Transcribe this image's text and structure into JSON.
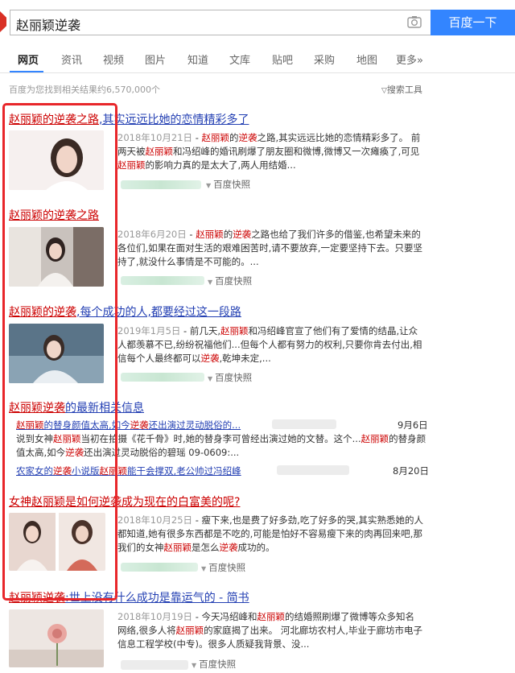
{
  "search": {
    "query": "赵丽颖逆袭",
    "button_label": "百度一下"
  },
  "tabs": [
    {
      "label": "网页",
      "active": true
    },
    {
      "label": "资讯"
    },
    {
      "label": "视频"
    },
    {
      "label": "图片"
    },
    {
      "label": "知道"
    },
    {
      "label": "文库"
    },
    {
      "label": "贴吧"
    },
    {
      "label": "采购"
    },
    {
      "label": "地图"
    },
    {
      "label": "更多»"
    }
  ],
  "result_count": "百度为您找到相关结果约6,570,000个",
  "search_tools": "搜索工具",
  "kuaizhao": "百度快照",
  "results": [
    {
      "title_hl": "赵丽颖的逆袭之路",
      "title_rest": ",其实远远比她的恋情精彩多了",
      "date": "2018年10月21日",
      "snippet": " - 赵丽颖的逆袭之路,其实远远比她的恋情精彩多了。 前两天被赵丽颖和冯绍峰的婚讯刷爆了朋友圈和微博,微博又一次瘫痪了,可见赵丽颖的影响力真的是太大了,两人用结婚..."
    },
    {
      "title_hl": "赵丽颖的逆袭之路",
      "title_rest": "",
      "date": "2018年6月20日",
      "snippet": " - 赵丽颖的逆袭之路也给了我们许多的借鉴,也希望未来的各位们,如果在面对生活的艰难困苦时,请不要放弃,一定要坚持下去。只要坚持了,就没什么事情是不可能的。..."
    },
    {
      "title_hl": "赵丽颖的逆袭",
      "title_rest": ",每个成功的人,都要经过这一段路",
      "date": "2019年1月5日",
      "snippet": " - 前几天,赵丽颖和冯绍峰官宣了他们有了爱情的结晶,让众人都羡慕不已,纷纷祝福他们...但每个人都有努力的权利,只要你肯去付出,相信每个人最终都可以逆袭,乾坤未定,..."
    },
    {
      "title_hl": "赵丽颖逆袭",
      "title_rest": "的最新相关信息",
      "news": [
        {
          "title": "赵丽颖的替身颜值太高,如今逆袭还出演过灵动脱俗的...",
          "date": "9月6日"
        },
        {
          "snippet": "说到女神赵丽颖当初在拍摄《花千骨》时,她的替身李可曾经出演过她的文替。这个...赵丽颖的替身颜值太高,如今逆袭还出演过灵动脱俗的碧瑶 09-0609:..."
        },
        {
          "title": "农家女的逆袭小说版赵丽颖能干会撑双,老公帅过冯绍峰",
          "date": "8月20日"
        }
      ]
    },
    {
      "title_hl": "女神赵丽颖是如何逆袭成为现在的白富美的呢?",
      "title_rest": "",
      "date": "2018年10月25日",
      "snippet": " - 瘦下来,也是费了好多劲,吃了好多的哭,其实熟悉她的人都知道,她有很多东西都是不吃的,可能是怕好不容易瘦下来的肉再回来吧,那我们的女神赵丽颖是怎么逆袭成功的。"
    },
    {
      "title_hl": "赵丽颖逆袭",
      "title_rest": ":世上没有什么成功是靠运气的 - 简书",
      "date": "2018年10月19日",
      "snippet": " - 今天冯绍峰和赵丽颖的结婚照刷爆了微博等众多知名网络,很多人将赵丽颖的家庭揭了出来。 河北廊坊农村人,毕业于廊坊市电子信息工程学校(中专)。很多人质疑我背景、没..."
    }
  ],
  "colors": {
    "link": "#2440b3",
    "highlight": "#cc0000",
    "button": "#3385ff",
    "annotation": "#e8262a"
  }
}
